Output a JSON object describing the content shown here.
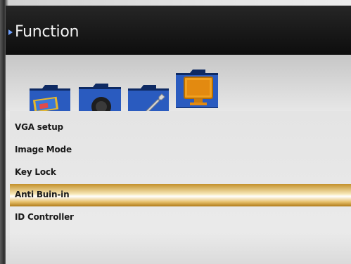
{
  "header": {
    "title": "Function"
  },
  "function_icons": [
    {
      "name": "picture-folder-icon"
    },
    {
      "name": "camera-folder-icon"
    },
    {
      "name": "tool-folder-icon"
    },
    {
      "name": "monitor-folder-icon",
      "active": true
    }
  ],
  "menu": {
    "items": [
      {
        "label": "VGA setup"
      },
      {
        "label": "Image Mode"
      },
      {
        "label": "Key Lock"
      },
      {
        "label": "Anti Buin-in",
        "selected": true
      },
      {
        "label": "ID Controller"
      }
    ]
  },
  "colors": {
    "title_bar": "#111111",
    "folder_blue": "#2a5bbf",
    "selection_gold": "#d8a842"
  }
}
